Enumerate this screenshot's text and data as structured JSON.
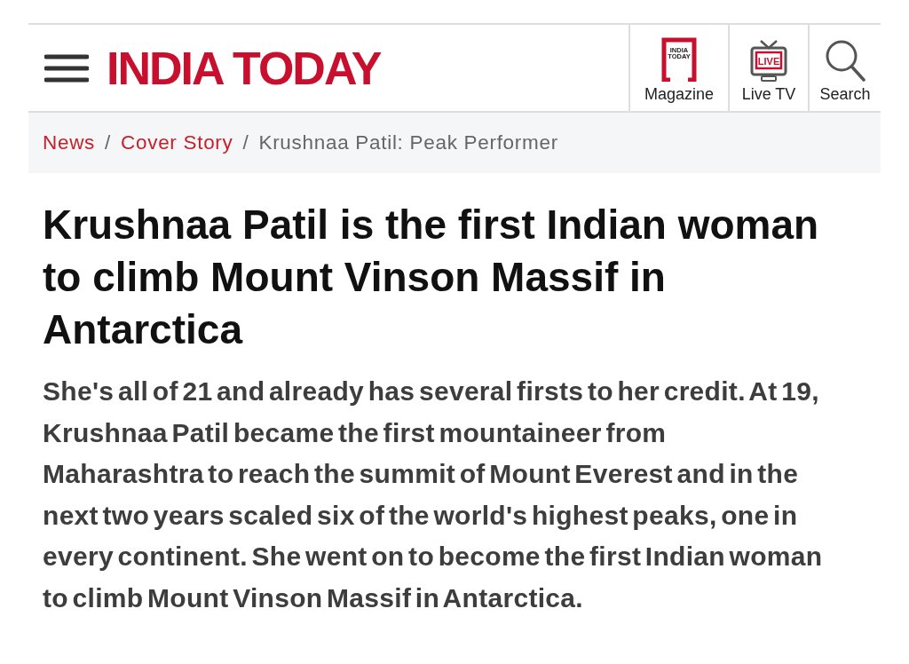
{
  "header": {
    "logo": "INDIA TODAY",
    "nav": [
      {
        "kind": "magazine",
        "label": "Magazine",
        "icon_text": [
          "INDIA",
          "TODAY"
        ]
      },
      {
        "kind": "live_tv",
        "label": "Live TV",
        "icon_text": [
          "LIVE"
        ]
      },
      {
        "kind": "search",
        "label": "Search"
      }
    ]
  },
  "breadcrumb": [
    {
      "kind": "link",
      "label": "News"
    },
    {
      "kind": "link",
      "separator": "/",
      "label": "Cover Story"
    },
    {
      "kind": "current",
      "separator": "/",
      "label": "Krushnaa Patil: Peak Performer"
    }
  ],
  "article": {
    "headline": "Krushnaa Patil is the first Indian woman to climb Mount Vinson Massif in Antarctica",
    "summary": "She's all of 21 and already has several firsts to her credit. At 19, Krushnaa Patil became the first mountaineer from Maharashtra to reach the summit of Mount Everest and in the next two years scaled six of the world's highest peaks, one in every continent. She went on to become the first Indian woman to climb Mount Vinson Massif in Antarctica."
  }
}
